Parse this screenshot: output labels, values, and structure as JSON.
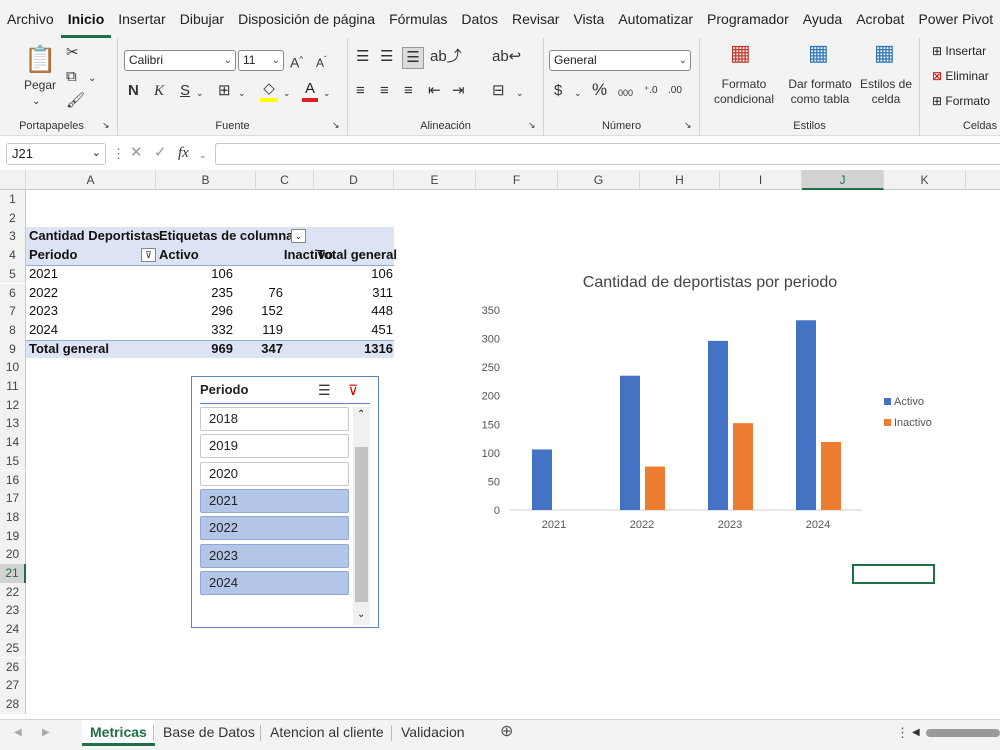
{
  "menu": [
    "Archivo",
    "Inicio",
    "Insertar",
    "Dibujar",
    "Disposición de página",
    "Fórmulas",
    "Datos",
    "Revisar",
    "Vista",
    "Automatizar",
    "Programador",
    "Ayuda",
    "Acrobat",
    "Power Pivot"
  ],
  "ribbon": {
    "paste_label": "Pegar",
    "groups": {
      "portapapeles": "Portapapeles",
      "fuente": "Fuente",
      "alineacion": "Alineación",
      "numero": "Número",
      "estilos": "Estilos",
      "celdas": "Celdas"
    },
    "font_name": "Calibri",
    "font_size": "11",
    "number_format": "General",
    "bold": "N",
    "italic": "K",
    "underline": "S",
    "cond_format": [
      "Formato",
      "condicional"
    ],
    "table_format": [
      "Dar formato",
      "como tabla"
    ],
    "cell_styles": [
      "Estilos de",
      "celda"
    ],
    "insert": "Insertar",
    "delete": "Eliminar",
    "format": "Formato"
  },
  "formula_bar": {
    "name_box": "J21",
    "fx": "fx",
    "formula": ""
  },
  "columns": [
    "A",
    "B",
    "C",
    "D",
    "E",
    "F",
    "G",
    "H",
    "I",
    "J",
    "K"
  ],
  "rows": [
    "1",
    "2",
    "3",
    "4",
    "5",
    "6",
    "7",
    "8",
    "9",
    "10",
    "11",
    "12",
    "13",
    "14",
    "15",
    "16",
    "17",
    "18",
    "19",
    "20",
    "21",
    "22",
    "23",
    "24",
    "25",
    "26",
    "27",
    "28"
  ],
  "pivot": {
    "title": "Cantidad Deportistas",
    "col_labels": "Etiquetas de columna",
    "row_header": "Periodo",
    "headers": [
      "Activo",
      "Inactivo",
      "Total general"
    ],
    "rows": [
      {
        "periodo": "2021",
        "activo": "106",
        "inactivo": "",
        "total": "106"
      },
      {
        "periodo": "2022",
        "activo": "235",
        "inactivo": "76",
        "total": "311"
      },
      {
        "periodo": "2023",
        "activo": "296",
        "inactivo": "152",
        "total": "448"
      },
      {
        "periodo": "2024",
        "activo": "332",
        "inactivo": "119",
        "total": "451"
      }
    ],
    "total": {
      "label": "Total general",
      "activo": "969",
      "inactivo": "347",
      "total": "1316"
    }
  },
  "slicer": {
    "title": "Periodo",
    "items": [
      {
        "label": "2018",
        "selected": false
      },
      {
        "label": "2019",
        "selected": false
      },
      {
        "label": "2020",
        "selected": false
      },
      {
        "label": "2021",
        "selected": true
      },
      {
        "label": "2022",
        "selected": true
      },
      {
        "label": "2023",
        "selected": true
      },
      {
        "label": "2024",
        "selected": true
      }
    ]
  },
  "chart_data": {
    "type": "bar",
    "title": "Cantidad de deportistas por periodo",
    "categories": [
      "2021",
      "2022",
      "2023",
      "2024"
    ],
    "series": [
      {
        "name": "Activo",
        "color": "#4472c4",
        "values": [
          106,
          235,
          296,
          332
        ]
      },
      {
        "name": "Inactivo",
        "color": "#ed7d31",
        "values": [
          0,
          76,
          152,
          119
        ]
      }
    ],
    "ylim": [
      0,
      350
    ],
    "yticks": [
      0,
      50,
      100,
      150,
      200,
      250,
      300,
      350
    ],
    "grid": false,
    "legend": "right"
  },
  "sheets": [
    "Metricas",
    "Base de Datos",
    "Atencion al cliente",
    "Validacion"
  ],
  "active_sheet": "Metricas"
}
